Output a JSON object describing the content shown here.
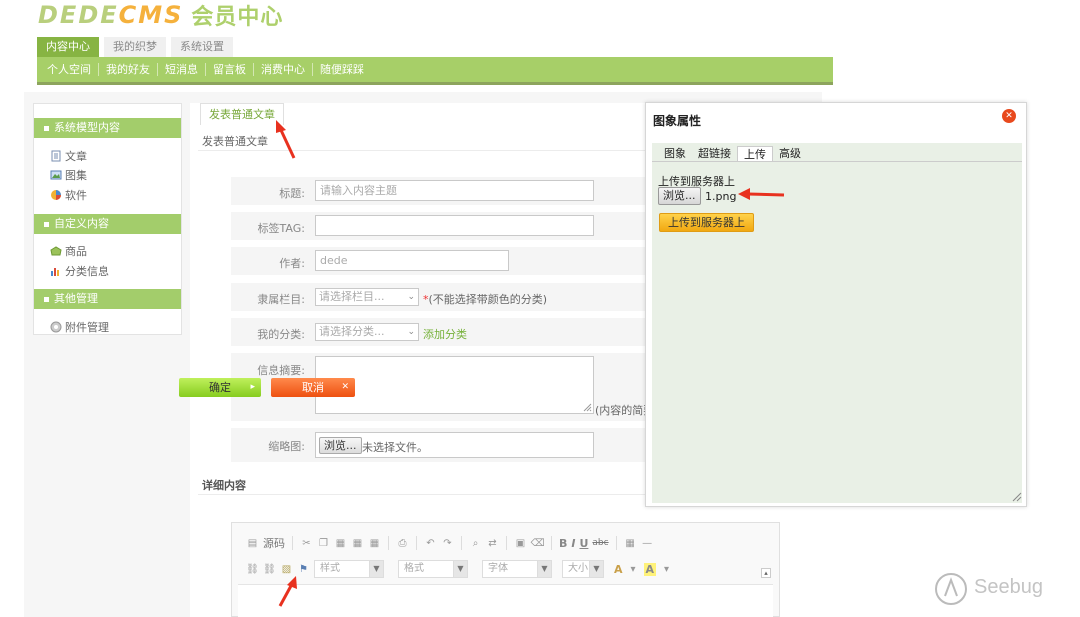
{
  "header": {
    "logo_part1": "DEDE",
    "logo_part2": "CMS",
    "logo_sub": "会员中心"
  },
  "tabs": [
    {
      "label": "内容中心",
      "active": true
    },
    {
      "label": "我的织梦",
      "active": false
    },
    {
      "label": "系统设置",
      "active": false
    }
  ],
  "nav": [
    "个人空间",
    "我的好友",
    "短消息",
    "留言板",
    "消费中心",
    "随便踩踩"
  ],
  "sidebar": {
    "sections": [
      {
        "title": "系统模型内容",
        "items": [
          {
            "label": "文章",
            "icon": "document-icon"
          },
          {
            "label": "图集",
            "icon": "gallery-icon"
          },
          {
            "label": "软件",
            "icon": "software-icon"
          }
        ]
      },
      {
        "title": "自定义内容",
        "items": [
          {
            "label": "商品",
            "icon": "product-icon"
          },
          {
            "label": "分类信息",
            "icon": "category-info-icon"
          }
        ]
      },
      {
        "title": "其他管理",
        "items": [
          {
            "label": "附件管理",
            "icon": "attachment-icon"
          }
        ]
      }
    ]
  },
  "content": {
    "tab_label": "发表普通文章",
    "title": "发表普通文章",
    "form": {
      "title_label": "标题:",
      "title_placeholder": "请输入内容主题",
      "tag_label": "标签TAG:",
      "author_label": "作者:",
      "author_value": "dede",
      "column_label": "隶属栏目:",
      "column_select": "请选择栏目...",
      "column_hint_mark": "*",
      "column_hint": "(不能选择带颜色的分类)",
      "category_label": "我的分类:",
      "category_select": "请选择分类...",
      "add_category": "添加分类",
      "summary_label": "信息摘要:",
      "summary_hint": "(内容的简要",
      "thumb_label": "缩略图:",
      "thumb_browse": "浏览...",
      "thumb_status": "未选择文件。"
    },
    "detail_title": "详细内容"
  },
  "editor": {
    "source": "源码",
    "style": "样式",
    "format": "格式",
    "font": "字体",
    "size": "大小",
    "bold": "B",
    "italic": "I",
    "underline": "U",
    "strike": "abc",
    "text_color": "A",
    "bg_color": "A"
  },
  "dialog": {
    "title": "图象属性",
    "tabs": [
      {
        "label": "图象",
        "active": false
      },
      {
        "label": "超链接",
        "active": false
      },
      {
        "label": "上传",
        "active": true
      },
      {
        "label": "高级",
        "active": false
      }
    ],
    "upload_label": "上传到服务器上",
    "browse": "浏览...",
    "filename": "1.png",
    "upload_button": "上传到服务器上",
    "ok": "确定",
    "cancel": "取消",
    "close_glyph": "✕"
  },
  "watermark": "Seebug",
  "colors": {
    "brand_green": "#a7cf68",
    "active_tab": "#87b443",
    "ok_green": "#86cc1f",
    "cancel_orange": "#ee5010",
    "arrow_red": "#e8311f"
  }
}
